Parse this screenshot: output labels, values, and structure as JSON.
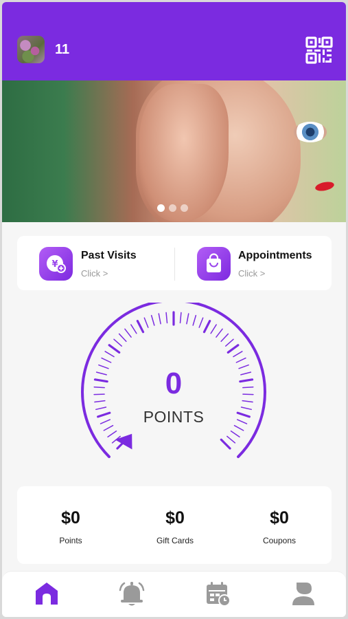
{
  "header": {
    "count": "11",
    "avatar_icon": "avatar",
    "qr_icon": "qr-code-icon",
    "background": "#7b2be0"
  },
  "banner": {
    "slide_count": 3,
    "active_slide": 1
  },
  "actions": [
    {
      "title": "Past Visits",
      "subtitle": "Click >",
      "icon": "coin-plus-icon"
    },
    {
      "title": "Appointments",
      "subtitle": "Click >",
      "icon": "shopping-bag-icon"
    }
  ],
  "gauge": {
    "value": "0",
    "label": "POINTS",
    "accent": "#7b2be0"
  },
  "balances": [
    {
      "amount": "$0",
      "label": "Points"
    },
    {
      "amount": "$0",
      "label": "Gift Cards"
    },
    {
      "amount": "$0",
      "label": "Coupons"
    }
  ],
  "nav": {
    "items": [
      "home-icon",
      "bell-icon",
      "calendar-clock-icon",
      "profile-icon"
    ],
    "active": "home-icon",
    "active_color": "#7b2be0",
    "inactive_color": "#9a9a9a"
  }
}
